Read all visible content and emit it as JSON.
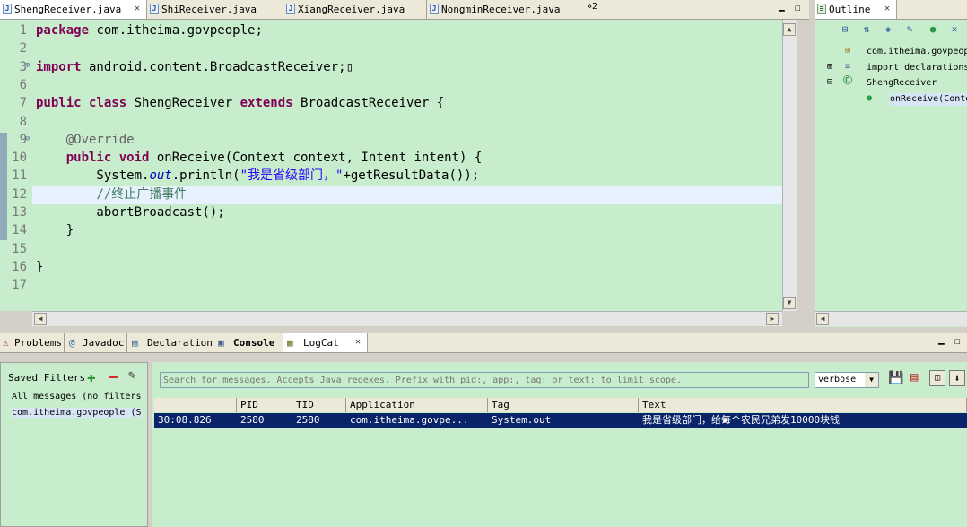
{
  "editor_tabs": [
    {
      "label": "ShengReceiver.java",
      "active": true
    },
    {
      "label": "ShiReceiver.java",
      "active": false
    },
    {
      "label": "XiangReceiver.java",
      "active": false
    },
    {
      "label": "NongminReceiver.java",
      "active": false
    }
  ],
  "editor_overflow": "»2",
  "code_lines": [
    {
      "n": "1",
      "html": "<span class='kw'>package</span> com.itheima.govpeople;"
    },
    {
      "n": "2",
      "html": ""
    },
    {
      "n": "3",
      "html": "<span class='kw'>import</span> android.content.BroadcastReceiver;▯"
    },
    {
      "n": "6",
      "html": ""
    },
    {
      "n": "7",
      "html": "<span class='kw'>public class</span> ShengReceiver <span class='kw'>extends</span> BroadcastReceiver {"
    },
    {
      "n": "8",
      "html": ""
    },
    {
      "n": "9",
      "html": "    <span class='an'>@Override</span>"
    },
    {
      "n": "10",
      "html": "    <span class='kw'>public void</span> onReceive(Context context, Intent intent) {"
    },
    {
      "n": "11",
      "html": "        System.<span class='it'>out</span>.println(<span class='st'>\"我是省级部门，\"</span>+getResultData());"
    },
    {
      "n": "12",
      "html": "        <span class='cm'>//终止广播事件</span>"
    },
    {
      "n": "13",
      "html": "        abortBroadcast();"
    },
    {
      "n": "14",
      "html": "    }"
    },
    {
      "n": "15",
      "html": ""
    },
    {
      "n": "16",
      "html": "}"
    },
    {
      "n": "17",
      "html": ""
    }
  ],
  "outline": {
    "tab_label": "Outline",
    "items": [
      "com.itheima.govpeople",
      "import declarations",
      "ShengReceiver",
      "onReceive(Context"
    ]
  },
  "bottom_tabs": [
    "Problems",
    "Javadoc",
    "Declaration",
    "Console",
    "LogCat"
  ],
  "logcat": {
    "saved_filters_label": "Saved Filters",
    "filters": [
      "All messages (no filters",
      "com.itheima.govpeople (S"
    ],
    "search_placeholder": "Search for messages. Accepts Java regexes. Prefix with pid:, app:, tag: or text: to limit scope.",
    "level": "verbose",
    "columns": [
      "",
      "PID",
      "TID",
      "Application",
      "Tag",
      "Text"
    ],
    "rows": [
      {
        "time": "30:08.826",
        "pid": "2580",
        "tid": "2580",
        "app": "com.itheima.govpe...",
        "tag": "System.out",
        "text": "我是省级部门，给每个农民兄弟发10000块钱"
      }
    ]
  },
  "colors": {
    "editor_bg": "#c7edcc",
    "selection": "#0a246a",
    "current_line": "#e8f2fe"
  }
}
